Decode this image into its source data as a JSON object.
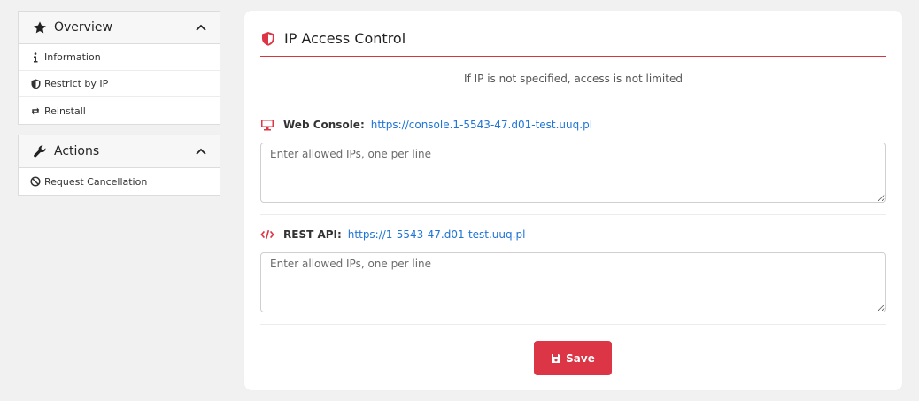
{
  "sidebar": {
    "overview": {
      "title": "Overview",
      "items": [
        {
          "label": "Information",
          "icon": "info-icon"
        },
        {
          "label": "Restrict by IP",
          "icon": "shield-icon"
        },
        {
          "label": "Reinstall",
          "icon": "retweet-icon"
        }
      ]
    },
    "actions": {
      "title": "Actions",
      "items": [
        {
          "label": "Request Cancellation",
          "icon": "ban-icon"
        }
      ]
    }
  },
  "main": {
    "title": "IP Access Control",
    "hint": "If IP is not specified, access is not limited",
    "web_console": {
      "label": "Web Console:",
      "url": "https://console.1-5543-47.d01-test.uuq.pl",
      "placeholder": "Enter allowed IPs, one per line",
      "value": ""
    },
    "rest_api": {
      "label": "REST API:",
      "url": "https://1-5543-47.d01-test.uuq.pl",
      "placeholder": "Enter allowed IPs, one per line",
      "value": ""
    },
    "save_label": "Save"
  },
  "colors": {
    "accent": "#dc3545",
    "link": "#1f74d6",
    "background": "#f1f1f1"
  }
}
